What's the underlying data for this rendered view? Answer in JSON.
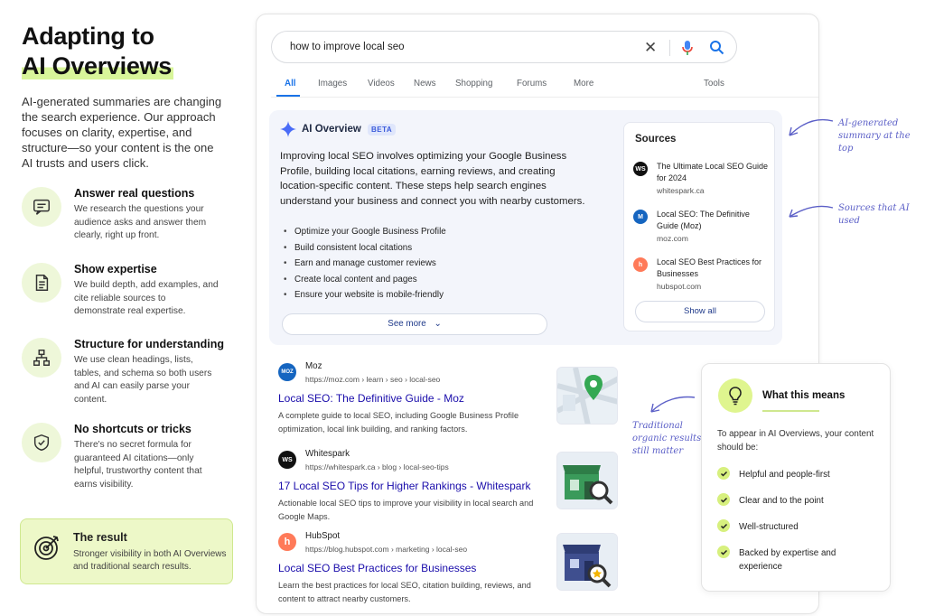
{
  "left": {
    "title_line1": "Adapting to",
    "title_line2": "AI Overviews",
    "intro": "AI-generated summaries are changing the search experience. Our approach focuses on clarity, expertise, and structure—so your content is the one AI trusts and users click.",
    "features": [
      {
        "title": "Answer real questions",
        "desc": "We research the questions your audience asks and answer them clearly, right up front.",
        "icon": "chat-icon"
      },
      {
        "title": "Show expertise",
        "desc": "We build depth, add examples, and cite reliable sources to demonstrate real expertise.",
        "icon": "document-icon"
      },
      {
        "title": "Structure for understanding",
        "desc": "We use clean headings, lists, tables, and schema so both users and AI can easily parse your content.",
        "icon": "sitemap-icon"
      },
      {
        "title": "No shortcuts or tricks",
        "desc": "There's no secret formula for guaranteed AI citations—only helpful, trustworthy content that earns visibility.",
        "icon": "shield-check-icon"
      }
    ],
    "result": {
      "title": "The result",
      "desc": "Stronger visibility in both AI Overviews and traditional search results.",
      "icon": "target-icon"
    }
  },
  "search": {
    "query": "how to improve local seo",
    "tabs": [
      "All",
      "Images",
      "Videos",
      "News",
      "Shopping",
      "Forums",
      "More",
      "Tools"
    ],
    "active_tab": "All"
  },
  "ai_overview": {
    "title": "AI Overview",
    "badge": "BETA",
    "paragraph": "Improving local SEO involves optimizing your Google Business Profile, building local citations, earning reviews, and creating location-specific content. These steps help search engines understand your business and connect you with nearby customers.",
    "bullets": [
      "Optimize your Google Business Profile",
      "Build consistent local citations",
      "Earn and manage customer reviews",
      "Create local content and pages",
      "Ensure your website is mobile-friendly"
    ],
    "see_more": "See more",
    "sources_title": "Sources",
    "sources": [
      {
        "title": "The Ultimate Local SEO Guide for 2024",
        "url": "whitespark.ca",
        "logo": "WS",
        "color": "#111111"
      },
      {
        "title": "Local SEO: The Definitive Guide (Moz)",
        "url": "moz.com",
        "logo": "M",
        "color": "#1565c0"
      },
      {
        "title": "Local SEO Best Practices for Businesses",
        "url": "hubspot.com",
        "logo": "h",
        "color": "#ff7a59"
      }
    ],
    "show_all": "Show all"
  },
  "results": [
    {
      "site": "Moz",
      "url": "https://moz.com › learn › seo › local-seo",
      "title": "Local SEO: The Definitive Guide - Moz",
      "snippet": "A complete guide to local SEO, including Google Business Profile optimization, local link building, and ranking factors.",
      "logo": "MOZ",
      "color": "#1565c0",
      "thumb": "map-pin-icon"
    },
    {
      "site": "Whitespark",
      "url": "https://whitespark.ca › blog › local-seo-tips",
      "title": "17 Local SEO Tips for Higher Rankings - Whitespark",
      "snippet": "Actionable local SEO tips to improve your visibility in local search and Google Maps.",
      "logo": "WS",
      "color": "#111111",
      "thumb": "storefront-search-icon"
    },
    {
      "site": "HubSpot",
      "url": "https://blog.hubspot.com › marketing › local-seo",
      "title": "Local SEO Best Practices for Businesses",
      "snippet": "Learn the best practices for local SEO, citation building, reviews, and content to attract nearby customers.",
      "logo": "h",
      "color": "#ff7a59",
      "thumb": "storefront-star-icon"
    }
  ],
  "annotations": {
    "ai_summary": "AI-generated summary at the top",
    "sources_used": "Sources that AI used",
    "organic": "Traditional organic results still matter"
  },
  "what_this_means": {
    "title": "What this means",
    "desc": "To appear in AI Overviews, your content should be:",
    "items": [
      "Helpful and people-first",
      "Clear and to the point",
      "Well-structured",
      "Backed by expertise and experience"
    ]
  },
  "colors": {
    "accent_green": "#d8f59a",
    "link_blue": "#1a0dab",
    "google_blue": "#1a73e8",
    "annotation_purple": "#5b5fc7"
  }
}
